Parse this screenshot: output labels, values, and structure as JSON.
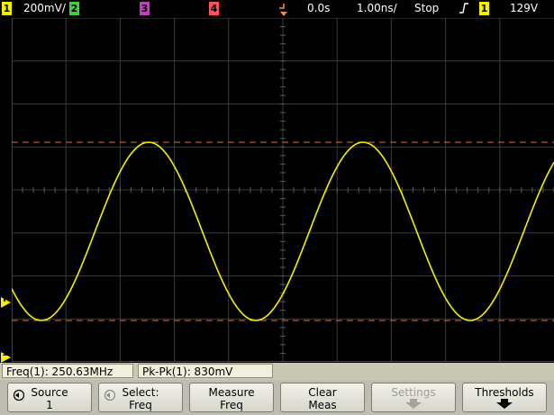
{
  "status_bar": {
    "ch1_num": "1",
    "ch1_scale": "200",
    "ch1_unit": "mV",
    "ch2_num": "2",
    "ch3_num": "3",
    "ch4_num": "4",
    "time_offset": "0.0s",
    "time_scale": "1.00",
    "time_unit": "ns",
    "run_state": "Stop",
    "trigger_slope": "↑",
    "trigger_source": "1",
    "trigger_level": "129V"
  },
  "colors": {
    "ch1": "#f4f000",
    "ch2": "#3fcf3f",
    "ch3": "#c040c0",
    "ch4": "#ff5060",
    "trigger": "#ff8a2a",
    "cursor": "#e07030",
    "grid": "#3a3a3a",
    "marker": "#ff8a2a"
  },
  "markers": {
    "ch1_ground": "1",
    "trigger_level": "T"
  },
  "waveform": {
    "channel": "1",
    "cycles_per_division": 0.25063,
    "amplitude_divisions": 4.15,
    "phase_shift_divisions": 0.0
  },
  "measurements": [
    {
      "label": "Freq(1): 250.63MHz"
    },
    {
      "label": "Pk-Pk(1): 830mV"
    }
  ],
  "softkeys": [
    {
      "line1": "Source",
      "line2": "1",
      "icon": "rotate-knob-icon",
      "enabled": true
    },
    {
      "line1": "Select:",
      "line2": "Freq",
      "icon": "rotate-knob-icon",
      "enabled": true
    },
    {
      "line1": "Measure",
      "line2": "Freq",
      "icon": "",
      "enabled": true
    },
    {
      "line1": "Clear",
      "line2": "Meas",
      "icon": "",
      "enabled": true
    },
    {
      "line1": "Settings",
      "line2": "",
      "icon": "down-arrow-icon",
      "enabled": false
    },
    {
      "line1": "Thresholds",
      "line2": "",
      "icon": "down-arrow-icon",
      "enabled": true
    }
  ]
}
